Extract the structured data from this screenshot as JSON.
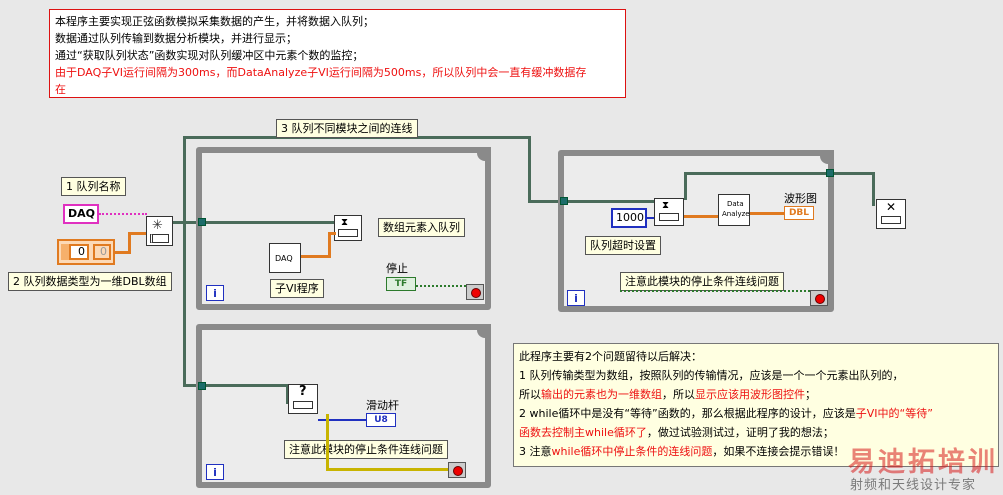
{
  "top_note": {
    "line1": "本程序主要实现正弦函数模拟采集数据的产生，并将数据入队列；",
    "line2": "数据通过队列传输到数据分析模块，并进行显示；",
    "line3": "通过“获取队列状态”函数实现对队列缓冲区中元素个数的监控；",
    "line4_a": "由于DAQ子VI",
    "line4_b": "运行间隔为300ms",
    "line4_c": "，而DataAnalyze子VI",
    "line4_d": "运行间隔为500ms",
    "line4_e": "，所以队列中会一直有缓冲数据存",
    "line5": "在"
  },
  "labels": {
    "queue_name": "1 队列名称",
    "queue_type": "2 队列数据类型为一维DBL数组",
    "connection": "3 队列不同模块之间的连线",
    "enqueue": "数组元素入队列",
    "subvi": "子VI程序",
    "stop": "停止",
    "timeout": "队列超时设置",
    "waveform": "波形图",
    "note_stop_right": "注意此模块的停止条件连线问题",
    "slider": "滑动杆",
    "note_stop_bottom": "注意此模块的停止条件连线问题"
  },
  "constants": {
    "daq_string": "DAQ",
    "num_a": "0",
    "num_b": "0",
    "timeout_value": "1000",
    "daq_sub": "DAQ",
    "data_analyze_1": "Data",
    "data_analyze_2": "Analyze"
  },
  "terminals": {
    "tf": "TF",
    "dbl": "DBL",
    "u8": "U8",
    "iteration": "i"
  },
  "bottom_note": {
    "line1": "此程序主要有2个问题留待以后解决：",
    "line2": "1 队列传输类型为数组，按照队列的传输情况，应该是一个一个元素出队列的，",
    "line3_a": "所以",
    "line3_b": "输出的元素也为一维数组",
    "line3_c": "，所以",
    "line3_d": "显示应该用波形图控件",
    "line3_e": "；",
    "line4_a": "2 while循环中是没有“等待”函数的，那么根据此程序的设计，应该是",
    "line4_b": "子VI中的“等待”",
    "line5_a": "函数去控制主while循环了",
    "line5_b": "，做过试验测试过，证明了我的想法；",
    "line6_a": "3 注意",
    "line6_b": "while循环中停止条件的连线问题",
    "line6_c": "，如果不连接会提示错误！"
  },
  "watermark": {
    "brand": "易迪拓培训",
    "tagline": "射频和天线设计专家"
  },
  "colors": {
    "dbl_wire": "#e07a20",
    "string_wire": "#e030c0",
    "queue_wire": "#4a6b5a",
    "bool_wire": "#2c7a2c",
    "accent_red": "#e11"
  }
}
